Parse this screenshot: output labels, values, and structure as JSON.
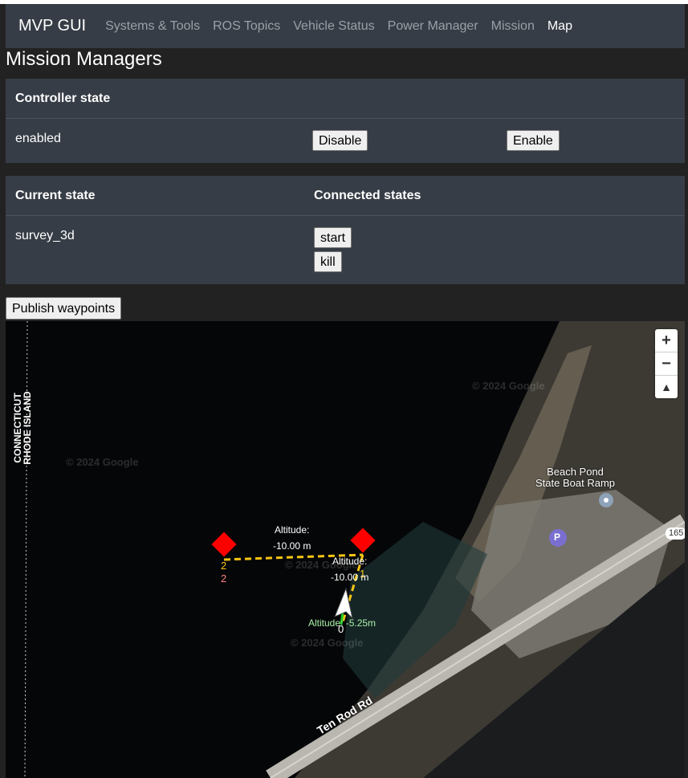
{
  "navbar": {
    "brand": "MVP GUI",
    "items": [
      "Systems & Tools",
      "ROS Topics",
      "Vehicle Status",
      "Power Manager",
      "Mission",
      "Map"
    ],
    "active": "Map"
  },
  "page_title": "Mission Managers",
  "controller_panel": {
    "header": "Controller state",
    "state": "enabled",
    "disable_label": "Disable",
    "enable_label": "Enable"
  },
  "state_panel": {
    "current_header": "Current state",
    "connected_header": "Connected states",
    "current_state": "survey_3d",
    "connected": [
      "start",
      "kill"
    ]
  },
  "publish_label": "Publish waypoints",
  "map": {
    "state_border": "CONNECTICUT RHODE ISLAND",
    "state_line1": "CONNECTICUT",
    "state_line2": "RHODE ISLAND",
    "place_line1": "Beach Pond",
    "place_line2": "State Boat Ramp",
    "road": "Ten Rod Rd",
    "route_number": "165",
    "parking_symbol": "P",
    "watermark": "© 2024 Google",
    "zoom_in": "+",
    "zoom_out": "−",
    "reset_north": "▲",
    "waypoints": [
      {
        "id": "2",
        "index_label": "2",
        "altitude_label": "Altitude:",
        "altitude_value": "-10.00 m"
      },
      {
        "id": "1",
        "index_label": "1",
        "altitude_label": "Altitude:",
        "altitude_value": "-10.00 m"
      }
    ],
    "vehicle": {
      "index_label": "0",
      "altitude_text": "Altitude: -5.25m"
    },
    "colors": {
      "waypoint": "#ff0000",
      "path": "#f7c514",
      "vehicle_heading": "#22cc22"
    }
  }
}
